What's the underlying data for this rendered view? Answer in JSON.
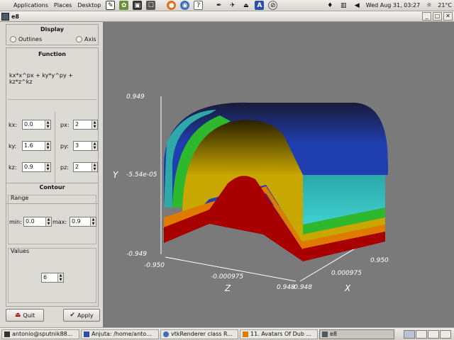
{
  "top_panel": {
    "menus": [
      "Applications",
      "Places",
      "Desktop"
    ],
    "clock": "Wed Aug 31, 03:27",
    "weather": "21°C"
  },
  "window": {
    "title": "e8"
  },
  "display": {
    "heading": "Display",
    "outlines_label": "Outlines",
    "axis_label": "Axis"
  },
  "function": {
    "heading": "Function",
    "expression": "kx*x^px + ky*y^py + kz*z^kz"
  },
  "params": {
    "kx_label": "kx:",
    "kx": "0.0",
    "ky_label": "ky:",
    "ky": "1.6",
    "kz_label": "kz:",
    "kz": "0.9",
    "px_label": "px:",
    "px": "2",
    "py_label": "py:",
    "py": "3",
    "pz_label": "pz:",
    "pz": "2"
  },
  "contour": {
    "heading": "Contour",
    "range_label": "Range",
    "min_label": "min:",
    "min": "0.0",
    "max_label": "max:",
    "max": "0.9",
    "values_label": "Values",
    "values": "6"
  },
  "buttons": {
    "quit": "Quit",
    "apply": "Apply"
  },
  "plot": {
    "y_label": "Y",
    "y_top": "0.949",
    "y_mid": "-5.54e-05",
    "y_bottom": "-0.949",
    "z_label": "Z",
    "z_start": "-0.950",
    "z_mid": "-0.000975",
    "z_end": "0.948",
    "x_label": "X",
    "x_start": "-0.948",
    "x_mid": "0.000975",
    "x_end": "0.950",
    "colors": {
      "background": "#7a7a7a",
      "blue": "#1f3fb0",
      "cyan": "#37c8c8",
      "green": "#2eb82e",
      "yellow": "#c8a800",
      "orange": "#e07a00",
      "red": "#a80000"
    }
  },
  "taskbar": {
    "tasks": [
      "antonio@sputnik88...",
      "Anjuta: /home/anto...",
      "vtkRenderer class R...",
      "11. Avatars Of Dub ...",
      "e8"
    ]
  }
}
